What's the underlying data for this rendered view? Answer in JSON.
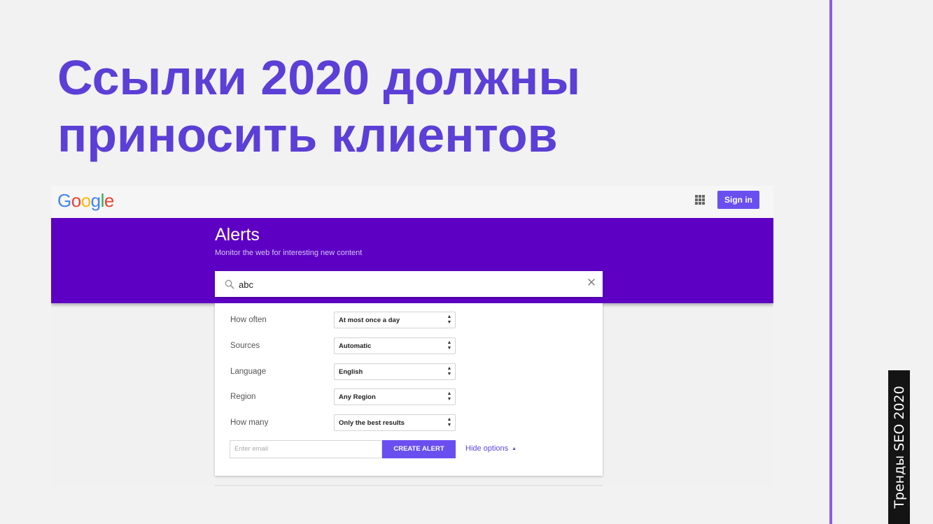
{
  "slide": {
    "title": "Ссылки 2020 должны приносить клиентов",
    "side_label": "Тренды SEO 2020"
  },
  "colors": {
    "title": "#5b3fd6",
    "divider": "#8a5ce6",
    "alerts_band": "#5d00c4",
    "primary_button": "#6a4ff0"
  },
  "header": {
    "logo_letters": [
      {
        "char": "G",
        "color": "#4285f4"
      },
      {
        "char": "o",
        "color": "#ea4335"
      },
      {
        "char": "o",
        "color": "#fbbc05"
      },
      {
        "char": "g",
        "color": "#4285f4"
      },
      {
        "char": "l",
        "color": "#34a853"
      },
      {
        "char": "e",
        "color": "#ea4335"
      }
    ],
    "apps_icon": "apps-grid-icon",
    "signin_label": "Sign in"
  },
  "alerts": {
    "title": "Alerts",
    "subtitle": "Monitor the web for interesting new content",
    "search_value": "abc",
    "search_icon": "search-icon",
    "clear_icon": "close-icon"
  },
  "options": {
    "rows": [
      {
        "label": "How often",
        "value": "At most once a day"
      },
      {
        "label": "Sources",
        "value": "Automatic"
      },
      {
        "label": "Language",
        "value": "English"
      },
      {
        "label": "Region",
        "value": "Any Region"
      },
      {
        "label": "How many",
        "value": "Only the best results"
      }
    ],
    "email_placeholder": "Enter email",
    "create_label": "CREATE ALERT",
    "hide_label": "Hide options"
  }
}
